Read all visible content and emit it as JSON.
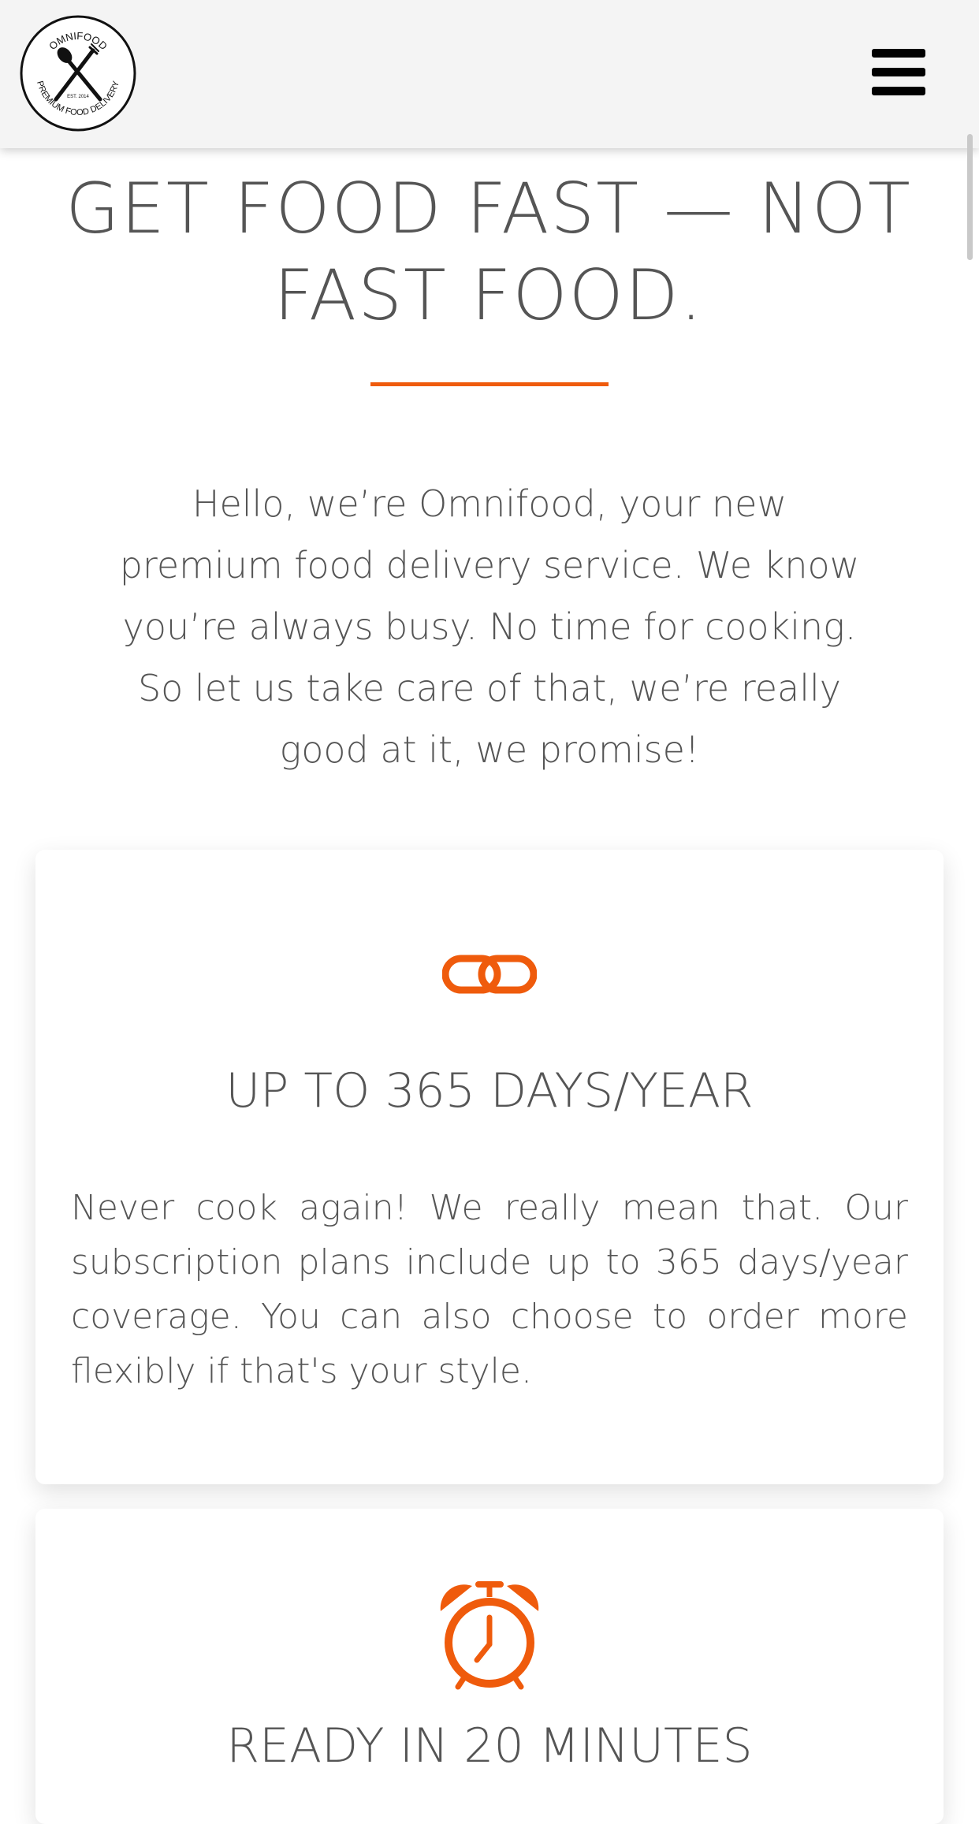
{
  "header": {
    "logo": {
      "top_text": "OMNIFOOD",
      "bottom_text": "PREMIUM FOOD DELIVERY",
      "est_text": "EST. 2014"
    },
    "menu_icon": "hamburger-menu-icon"
  },
  "hero": {
    "title": "GET FOOD FAST — NOT FAST FOOD.",
    "intro": "Hello, we’re Omnifood, your new premium food delivery service. We know you’re always busy. No time for cooking. So let us take care of that, we’re really good at it, we promise!"
  },
  "features": [
    {
      "icon": "chain-link-icon",
      "title": "UP TO 365 DAYS/YEAR",
      "text": "Never cook again! We really mean that. Our subscription plans include up to 365 days/year coverage. You can also choose to order more flexibly if that's your style."
    },
    {
      "icon": "alarm-clock-icon",
      "title": "READY IN 20 MINUTES"
    }
  ],
  "colors": {
    "accent": "#ef5b0c",
    "text": "#555555",
    "header_bg": "#f4f4f4"
  }
}
